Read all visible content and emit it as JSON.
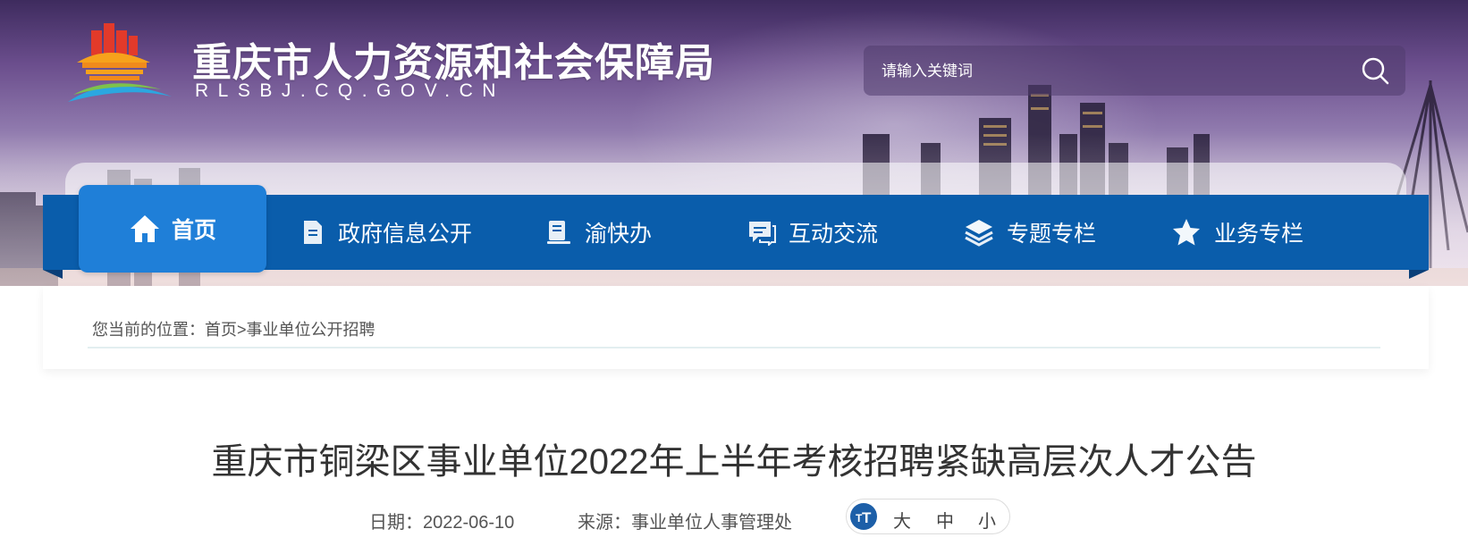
{
  "header": {
    "site_title": "重庆市人力资源和社会保障局",
    "site_domain": "RLSBJ.CQ.GOV.CN"
  },
  "search": {
    "placeholder": "请输入关键词"
  },
  "nav": {
    "items": [
      {
        "label": "首页",
        "icon": "home-icon",
        "active": true
      },
      {
        "label": "政府信息公开",
        "icon": "document-icon"
      },
      {
        "label": "渝快办",
        "icon": "book-icon"
      },
      {
        "label": "互动交流",
        "icon": "chat-icon"
      },
      {
        "label": "专题专栏",
        "icon": "layers-icon"
      },
      {
        "label": "业务专栏",
        "icon": "star-icon"
      }
    ]
  },
  "breadcrumb": {
    "prefix": "您当前的位置：",
    "home": "首页",
    "separator": ">",
    "current": "事业单位公开招聘"
  },
  "article": {
    "title": "重庆市铜梁区事业单位2022年上半年考核招聘紧缺高层次人才公告",
    "date_label": "日期：",
    "date": "2022-06-10",
    "source_label": "来源：",
    "source": "事业单位人事管理处",
    "font_size": {
      "large": "大",
      "medium": "中",
      "small": "小"
    }
  },
  "colors": {
    "nav_bg": "#0a5dab",
    "nav_active": "#1f7fd8",
    "font_icon_bg": "#1d5fa8"
  }
}
